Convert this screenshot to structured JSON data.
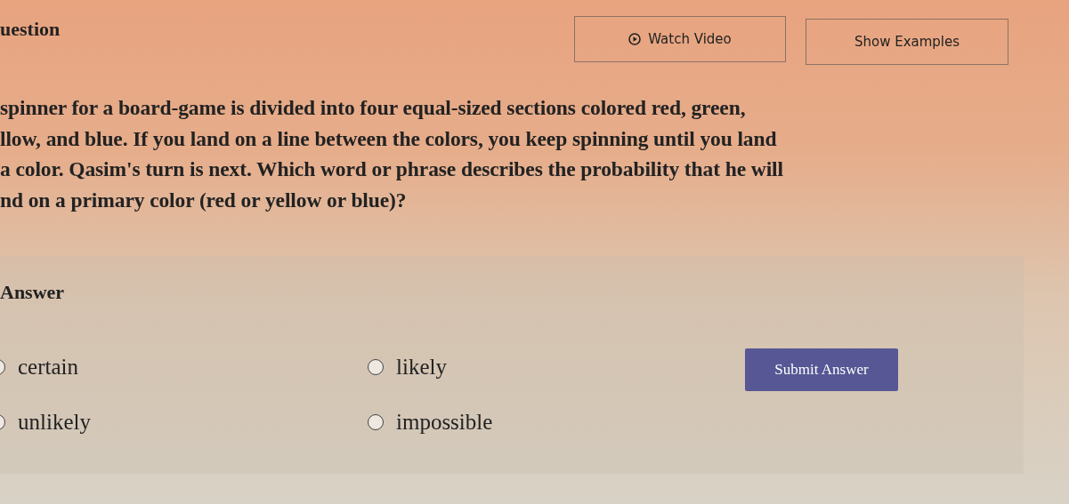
{
  "header": {
    "title": "uestion",
    "buttons": [
      {
        "kind": "video",
        "label": "Watch Video"
      },
      {
        "kind": "plain",
        "label": "Show Examples"
      }
    ]
  },
  "question_lines": [
    "spinner for a board-game is divided into four equal-sized sections colored red, green,",
    "llow, and blue. If you land on a line between the colors, you keep spinning until you land",
    "a color. Qasim's turn is next. Which word or phrase describes the probability that he will",
    "nd on a primary color (red or yellow or blue)?"
  ],
  "answer": {
    "heading": "Answer",
    "options": [
      {
        "label": "certain",
        "selected": false
      },
      {
        "label": "likely",
        "selected": false
      },
      {
        "label": "unlikely",
        "selected": false
      },
      {
        "label": "impossible",
        "selected": false
      }
    ],
    "submit": "Submit Answer"
  }
}
